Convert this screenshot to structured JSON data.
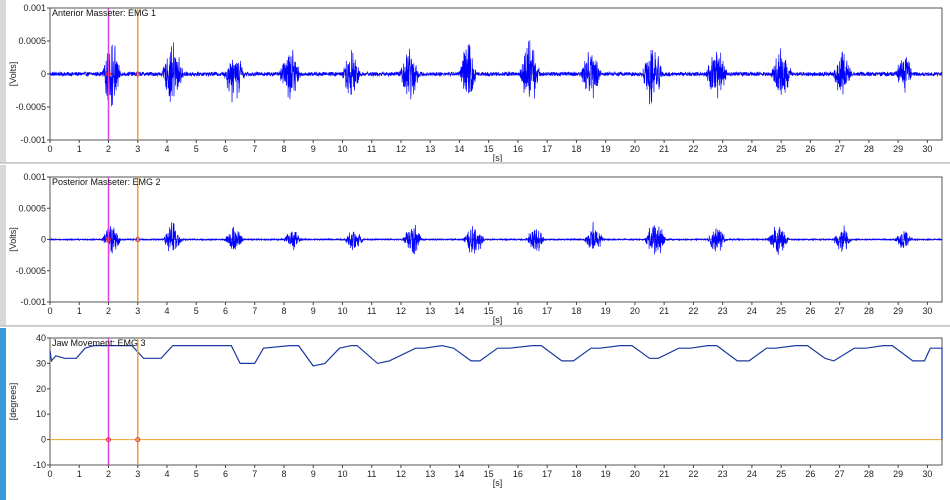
{
  "chart_data": [
    {
      "type": "line",
      "title": "Anterior Masseter: EMG 1",
      "xlabel": "[s]",
      "ylabel": "[Volts]",
      "xlim": [
        0,
        30.5
      ],
      "ylim": [
        -0.001,
        0.001
      ],
      "x_ticks": [
        "0",
        "1",
        "2",
        "3",
        "4",
        "5",
        "6",
        "7",
        "8",
        "9",
        "10",
        "11",
        "12",
        "13",
        "14",
        "15",
        "16",
        "17",
        "18",
        "19",
        "20",
        "21",
        "22",
        "23",
        "24",
        "25",
        "26",
        "27",
        "28",
        "29",
        "30"
      ],
      "y_ticks": [
        "0.001",
        "0.0005",
        "0",
        "-0.0005",
        "-0.001"
      ],
      "y_tick_values": [
        0.001,
        0.0005,
        0,
        -0.0005,
        -0.001
      ],
      "series": [
        {
          "color": "#0000ff",
          "baseline_amplitude": 3e-05
        }
      ],
      "bursts": [
        {
          "center": 2.1,
          "width": 0.8,
          "amp": 0.0006
        },
        {
          "center": 4.2,
          "width": 0.9,
          "amp": 0.00055
        },
        {
          "center": 6.3,
          "width": 0.9,
          "amp": 0.0005
        },
        {
          "center": 8.2,
          "width": 0.9,
          "amp": 0.00048
        },
        {
          "center": 10.3,
          "width": 0.8,
          "amp": 0.00045
        },
        {
          "center": 12.3,
          "width": 0.9,
          "amp": 0.0005
        },
        {
          "center": 14.3,
          "width": 0.8,
          "amp": 0.0006
        },
        {
          "center": 16.4,
          "width": 0.9,
          "amp": 0.00055
        },
        {
          "center": 18.5,
          "width": 0.9,
          "amp": 0.0005
        },
        {
          "center": 20.6,
          "width": 0.9,
          "amp": 0.00055
        },
        {
          "center": 22.8,
          "width": 0.9,
          "amp": 0.00055
        },
        {
          "center": 25.0,
          "width": 0.9,
          "amp": 0.0005
        },
        {
          "center": 27.1,
          "width": 0.8,
          "amp": 0.00042
        },
        {
          "center": 29.2,
          "width": 0.8,
          "amp": 0.00035
        }
      ],
      "markers": [
        {
          "x": 2,
          "color": "#e040e0"
        },
        {
          "x": 3,
          "color": "#f0a030"
        }
      ],
      "zero_line_color": "#f0a030"
    },
    {
      "type": "line",
      "title": "Posterior Masseter: EMG 2",
      "xlabel": "[s]",
      "ylabel": "[Volts]",
      "xlim": [
        0,
        30.5
      ],
      "ylim": [
        -0.001,
        0.001
      ],
      "x_ticks": [
        "0",
        "1",
        "2",
        "3",
        "4",
        "5",
        "6",
        "7",
        "8",
        "9",
        "10",
        "11",
        "12",
        "13",
        "14",
        "15",
        "16",
        "17",
        "18",
        "19",
        "20",
        "21",
        "22",
        "23",
        "24",
        "25",
        "26",
        "27",
        "28",
        "29",
        "30"
      ],
      "y_ticks": [
        "0.001",
        "0.0005",
        "0",
        "-0.0005",
        "-0.001"
      ],
      "y_tick_values": [
        0.001,
        0.0005,
        0,
        -0.0005,
        -0.001
      ],
      "series": [
        {
          "color": "#0000ff",
          "baseline_amplitude": 1e-05
        }
      ],
      "bursts": [
        {
          "center": 2.1,
          "width": 0.8,
          "amp": 0.00035
        },
        {
          "center": 4.2,
          "width": 0.8,
          "amp": 0.0003
        },
        {
          "center": 6.3,
          "width": 0.8,
          "amp": 0.00025
        },
        {
          "center": 8.3,
          "width": 0.8,
          "amp": 0.0002
        },
        {
          "center": 10.4,
          "width": 0.8,
          "amp": 0.00025
        },
        {
          "center": 12.4,
          "width": 0.8,
          "amp": 0.0003
        },
        {
          "center": 14.5,
          "width": 0.9,
          "amp": 0.00035
        },
        {
          "center": 16.6,
          "width": 0.8,
          "amp": 0.00025
        },
        {
          "center": 18.6,
          "width": 0.8,
          "amp": 0.0003
        },
        {
          "center": 20.7,
          "width": 0.9,
          "amp": 0.00035
        },
        {
          "center": 22.8,
          "width": 0.8,
          "amp": 0.00025
        },
        {
          "center": 24.9,
          "width": 0.9,
          "amp": 0.0003
        },
        {
          "center": 27.1,
          "width": 0.8,
          "amp": 0.00025
        },
        {
          "center": 29.2,
          "width": 0.8,
          "amp": 0.0002
        }
      ],
      "markers": [
        {
          "x": 2,
          "color": "#e040e0"
        },
        {
          "x": 3,
          "color": "#f0a030"
        }
      ],
      "zero_line_color": "#f0a030"
    },
    {
      "type": "line",
      "title": "Jaw Movement: EMG 3",
      "xlabel": "[s]",
      "ylabel": "[degrees]",
      "xlim": [
        0,
        30.5
      ],
      "ylim": [
        -10,
        40
      ],
      "x_ticks": [
        "0",
        "1",
        "2",
        "3",
        "4",
        "5",
        "6",
        "7",
        "8",
        "9",
        "10",
        "11",
        "12",
        "13",
        "14",
        "15",
        "16",
        "17",
        "18",
        "19",
        "20",
        "21",
        "22",
        "23",
        "24",
        "25",
        "26",
        "27",
        "28",
        "29",
        "30"
      ],
      "y_ticks": [
        "40",
        "30",
        "20",
        "10",
        "0",
        "-10"
      ],
      "y_tick_values": [
        40,
        30,
        20,
        10,
        0,
        -10
      ],
      "series": [
        {
          "color": "#1a3aa0",
          "x": [
            0,
            0.05,
            0.2,
            0.5,
            0.9,
            1.2,
            1.5,
            2.8,
            3.2,
            3.8,
            4.2,
            6.2,
            6.5,
            7.0,
            7.3,
            8.2,
            8.5,
            9.0,
            9.4,
            9.9,
            10.3,
            10.5,
            11.2,
            11.6,
            12.5,
            12.8,
            13.4,
            13.8,
            14.4,
            14.7,
            15.3,
            15.7,
            16.5,
            16.8,
            17.5,
            17.9,
            18.5,
            18.8,
            19.5,
            19.9,
            20.5,
            20.8,
            21.5,
            21.9,
            22.5,
            22.8,
            23.5,
            23.9,
            24.5,
            24.8,
            25.5,
            25.9,
            26.5,
            26.8,
            27.5,
            27.9,
            28.5,
            28.8,
            29.5,
            29.9,
            30.1,
            30.1,
            30.5,
            30.5
          ],
          "y": [
            35,
            31,
            33,
            32,
            32,
            36,
            37,
            37,
            32,
            32,
            37,
            37,
            30,
            30,
            36,
            37,
            37,
            29,
            30,
            36,
            37,
            37,
            30,
            31,
            36,
            36,
            37,
            36,
            31,
            31,
            36,
            36,
            37,
            37,
            31,
            31,
            36,
            36,
            37,
            37,
            32,
            32,
            36,
            36,
            37,
            37,
            31,
            31,
            36,
            36,
            37,
            37,
            32,
            31,
            36,
            36,
            37,
            37,
            31,
            31,
            36,
            36,
            36,
            0
          ]
        }
      ],
      "markers": [
        {
          "x": 2,
          "color": "#e040e0"
        },
        {
          "x": 3,
          "color": "#f0a030"
        }
      ],
      "zero_line_color": "#f0a030"
    }
  ]
}
